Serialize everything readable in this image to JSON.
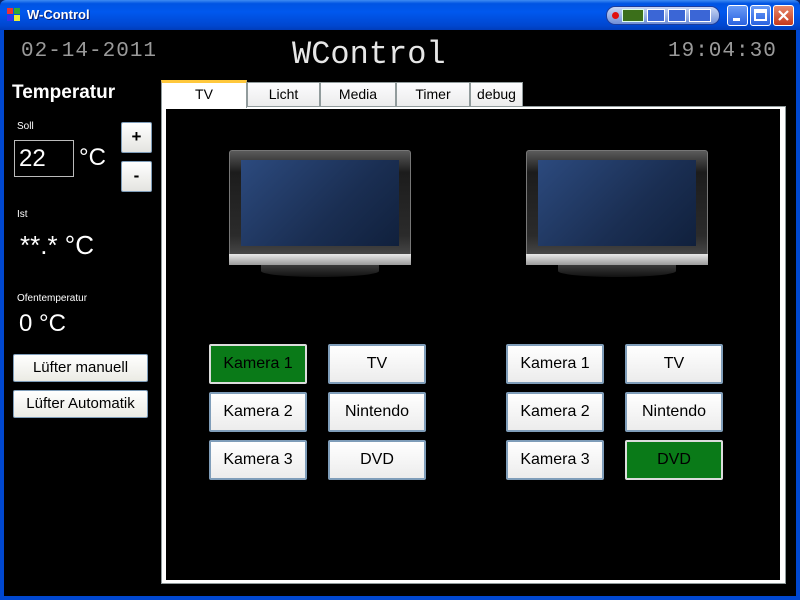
{
  "window": {
    "title": "W-Control"
  },
  "header": {
    "date": "02-14-2011",
    "title": "WControl",
    "time": "19:04:30"
  },
  "temperature": {
    "heading": "Temperatur",
    "soll_label": "Soll",
    "soll_value": "22",
    "soll_unit": "°C",
    "plus_label": "+",
    "minus_label": "-",
    "ist_label": "Ist",
    "ist_value": "**.* °C",
    "ofen_label": "Ofentemperatur",
    "ofen_value": "0 °C",
    "fan_manual_label": "Lüfter manuell",
    "fan_auto_label": "Lüfter Automatik"
  },
  "tabs": [
    {
      "label": "TV",
      "active": true
    },
    {
      "label": "Licht"
    },
    {
      "label": "Media"
    },
    {
      "label": "Timer"
    },
    {
      "label": "debug"
    }
  ],
  "tv_left": {
    "sources": [
      "Kamera 1",
      "TV",
      "Kamera 2",
      "Nintendo",
      "Kamera 3",
      "DVD"
    ],
    "active_source": "Kamera 1"
  },
  "tv_right": {
    "sources": [
      "Kamera 1",
      "TV",
      "Kamera 2",
      "Nintendo",
      "Kamera 3",
      "DVD"
    ],
    "active_source": "DVD"
  },
  "colors": {
    "active_source": "#0a7a18",
    "titlebar": "#0054e3",
    "tab_highlight": "#ffc83c"
  }
}
